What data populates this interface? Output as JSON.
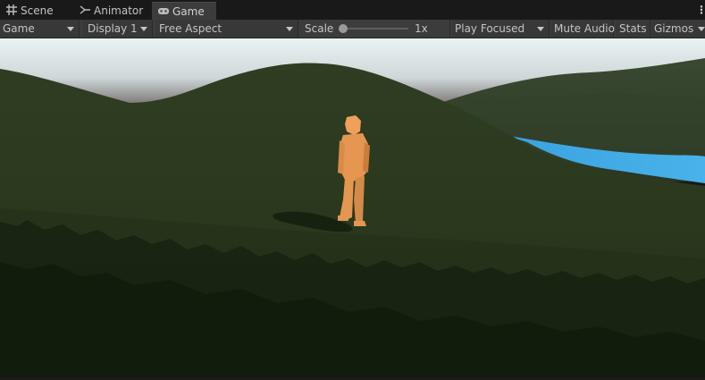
{
  "tabs": [
    {
      "label": "Scene",
      "icon": "grid-icon"
    },
    {
      "label": "Animator",
      "icon": "animator-icon"
    },
    {
      "label": "Game",
      "icon": "gamepad-icon",
      "active": true
    }
  ],
  "toolbar": {
    "view_mode": "Game",
    "display": "Display 1",
    "aspect": "Free Aspect",
    "scale_label": "Scale",
    "scale_value": "1x",
    "play_mode": "Play Focused",
    "mute_audio": "Mute Audio",
    "stats": "Stats",
    "gizmos": "Gizmos"
  },
  "colors": {
    "panel_bg": "#191919",
    "toolbar_bg": "#3c3c3c",
    "terrain": "#2c3a1e",
    "water": "#3ea6e0",
    "character": "#e59650"
  }
}
